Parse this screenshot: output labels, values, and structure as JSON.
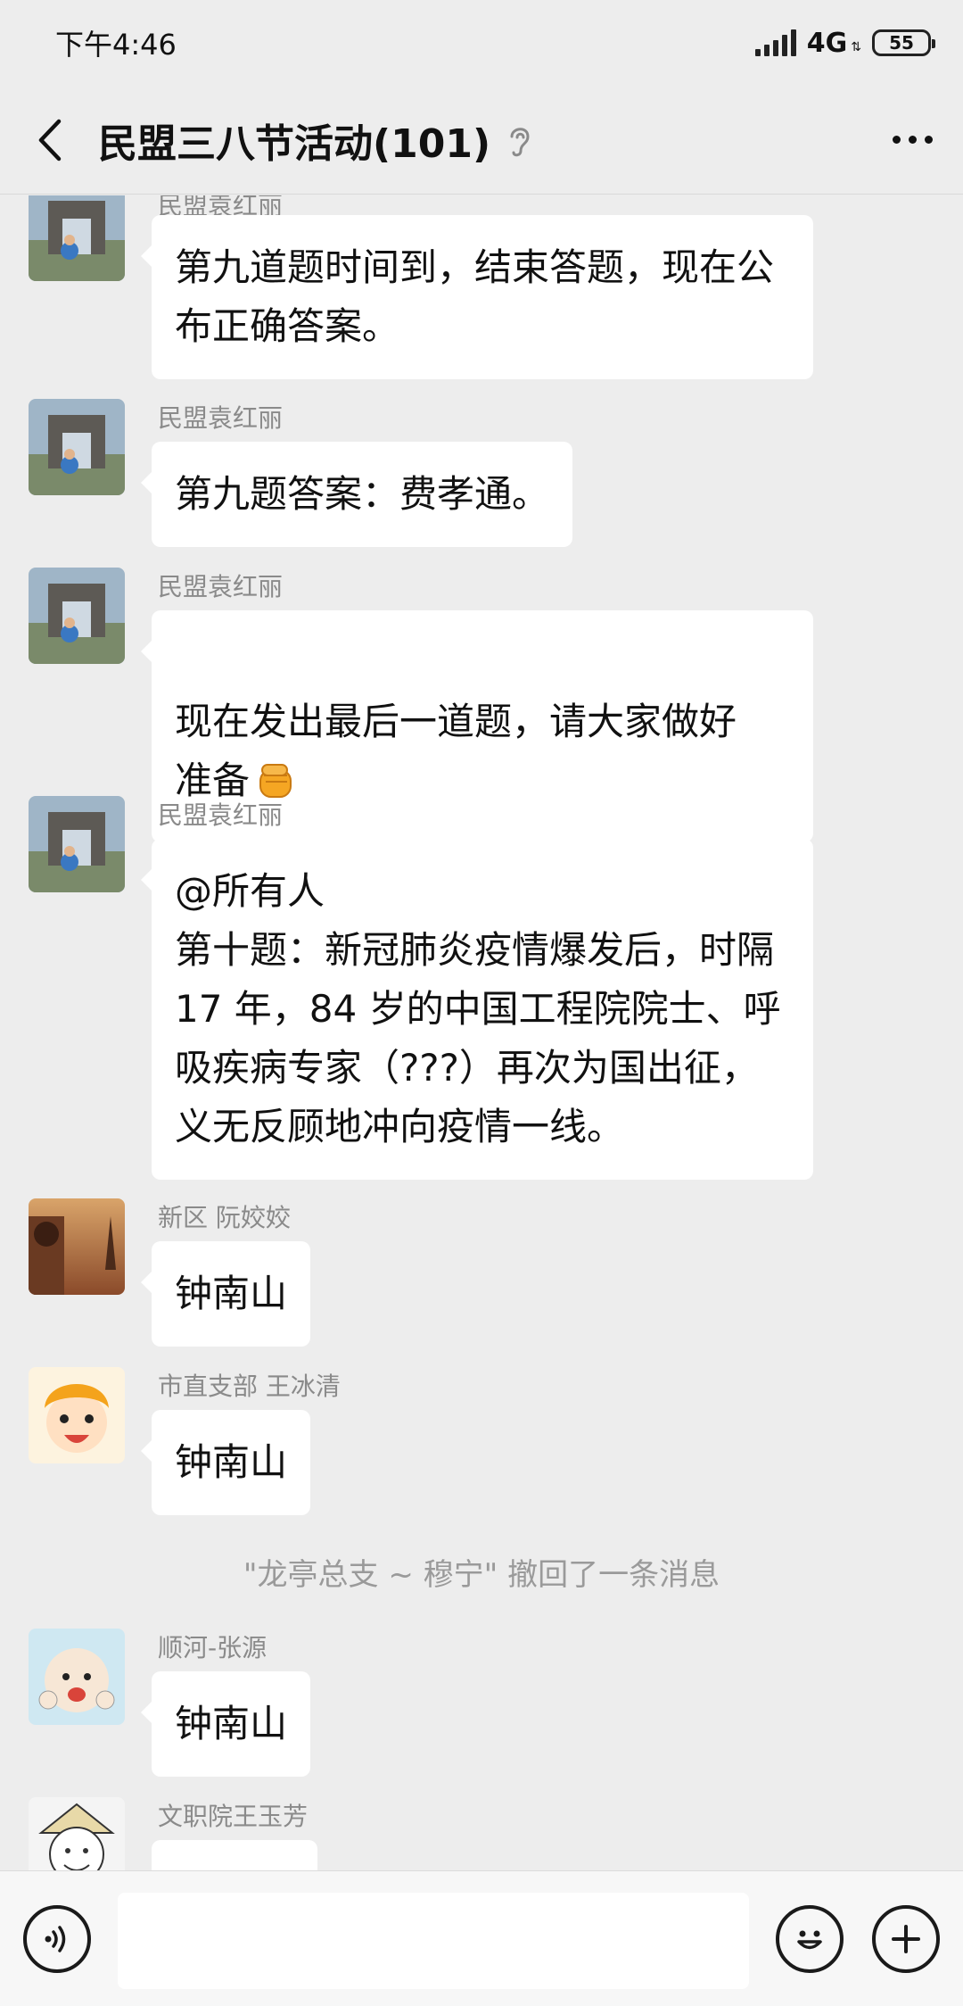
{
  "status_bar": {
    "time": "下午4:46",
    "network": "4G",
    "battery": "55"
  },
  "header": {
    "title": "民盟三八节活动(101)",
    "back_icon": "chevron-left-icon",
    "earpiece_icon": "ear-icon",
    "more_icon": "more-dots-icon"
  },
  "messages": [
    {
      "sender": "民盟袁红丽",
      "text": "第九道题时间到，结束答题，现在公\n布正确答案。",
      "avatar": "landmark-photo"
    },
    {
      "sender": "民盟袁红丽",
      "text": "第九题答案：费孝通。",
      "avatar": "landmark-photo"
    },
    {
      "sender": "民盟袁红丽",
      "text": "现在发出最后一道题，请大家做好\n准备",
      "emoji": "fist-emoji",
      "avatar": "landmark-photo"
    },
    {
      "sender": "民盟袁红丽",
      "text": "@所有人\n第十题：新冠肺炎疫情爆发后，时隔\n17 年，84 岁的中国工程院院士、呼\n吸疾病专家（???）再次为国出征，\n义无反顾地冲向疫情一线。",
      "avatar": "landmark-photo"
    },
    {
      "sender": "新区 阮姣姣",
      "text": "钟南山",
      "avatar": "eiffel-tower-photo"
    },
    {
      "sender": "市直支部 王冰清",
      "text": "钟南山",
      "avatar": "cartoon-girl"
    },
    {
      "sender": "顺河-张源",
      "text": "钟南山",
      "avatar": "cartoon-monk"
    },
    {
      "sender": "文职院王玉芳",
      "text": "",
      "avatar": "cartoon-sketch"
    }
  ],
  "system_notice": "\"龙亭总支 ~ 穆宁\" 撤回了一条消息",
  "input_bar": {
    "voice_icon": "voice-icon",
    "emoji_icon": "smiley-icon",
    "plus_icon": "plus-icon",
    "value": ""
  }
}
